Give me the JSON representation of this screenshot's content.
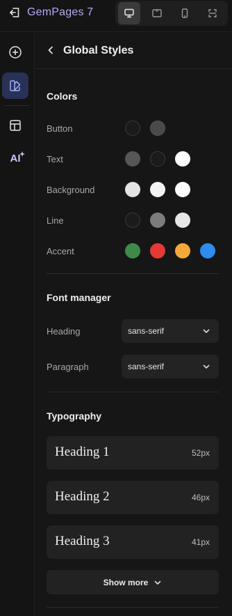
{
  "app": {
    "brand_name": "GemPages",
    "brand_version": "7"
  },
  "devices": [
    {
      "name": "desktop",
      "active": true
    },
    {
      "name": "tablet",
      "active": false
    },
    {
      "name": "mobile",
      "active": false
    },
    {
      "name": "fit-screen",
      "active": false
    }
  ],
  "rail": {
    "items": [
      {
        "name": "add-icon",
        "active": false
      },
      {
        "name": "global-styles-icon",
        "active": true
      },
      {
        "name": "layout-icon",
        "active": false
      },
      {
        "name": "ai-icon",
        "label": "AI",
        "active": false
      }
    ]
  },
  "panel": {
    "title": "Global Styles",
    "colors": {
      "title": "Colors",
      "rows": [
        {
          "label": "Button",
          "swatches": [
            "#1b1b1b",
            "#4a4a4a"
          ]
        },
        {
          "label": "Text",
          "swatches": [
            "#565656",
            "#1b1b1b",
            "#ffffff"
          ]
        },
        {
          "label": "Background",
          "swatches": [
            "#e3e3e3",
            "#f3f3f3",
            "#ffffff"
          ]
        },
        {
          "label": "Line",
          "swatches": [
            "#1b1b1b",
            "#7c7c7c",
            "#e6e6e6"
          ]
        },
        {
          "label": "Accent",
          "swatches": [
            "#3f8a4a",
            "#e53935",
            "#f2a93b",
            "#2c8cf0"
          ]
        }
      ]
    },
    "font_manager": {
      "title": "Font manager",
      "heading": {
        "label": "Heading",
        "value": "sans-serif"
      },
      "paragraph": {
        "label": "Paragraph",
        "value": "sans-serif"
      }
    },
    "typography": {
      "title": "Typography",
      "items": [
        {
          "name": "Heading 1",
          "size": "52px"
        },
        {
          "name": "Heading 2",
          "size": "46px"
        },
        {
          "name": "Heading 3",
          "size": "41px"
        }
      ],
      "show_more_label": "Show more"
    }
  }
}
